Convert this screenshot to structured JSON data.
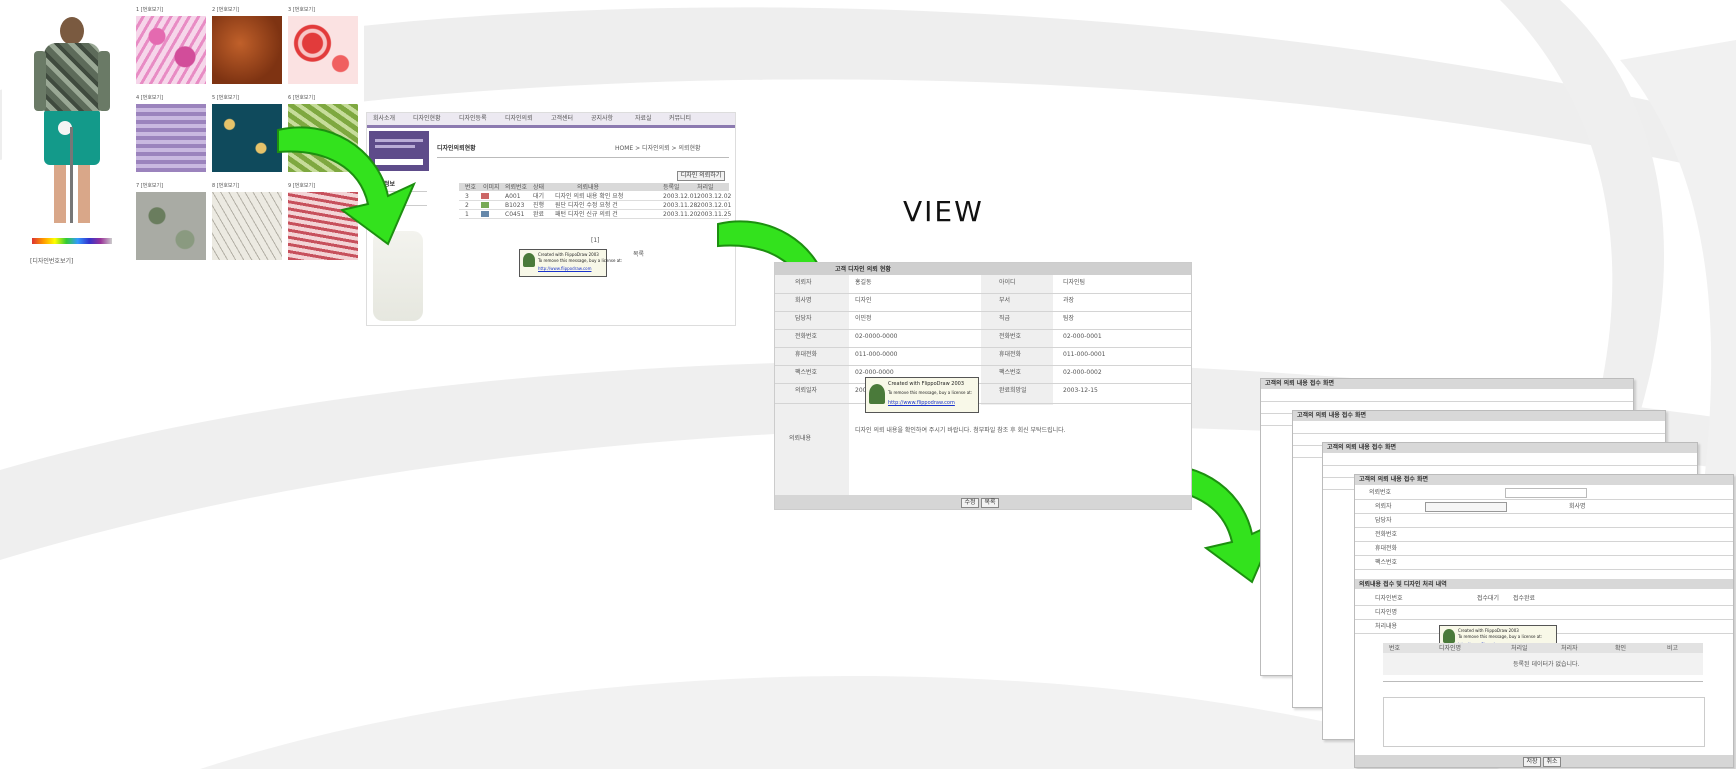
{
  "view_label": "VIEW",
  "step1": {
    "swatch_headers": [
      "1 [번호보기]",
      "2 [번호보기]",
      "3 [번호보기]",
      "4 [번호보기]",
      "5 [번호보기]",
      "6 [번호보기]",
      "7 [번호보기]",
      "8 [번호보기]",
      "9 [번호보기]"
    ],
    "caption": "[디자인번호보기]"
  },
  "step2": {
    "nav_items": [
      "회사소개",
      "디자인현황",
      "디자인등록",
      "디자인의뢰",
      "고객센터",
      "공지사항",
      "자료실",
      "커뮤니티"
    ],
    "sidebar_title": "회원정보",
    "page_title": "디자인의뢰현황",
    "breadcrumb": "HOME > 디자인의뢰 > 의뢰현황",
    "table_headers": [
      "번호",
      "이미지",
      "의뢰번호",
      "상태",
      "의뢰내용",
      "등록일",
      "처리일"
    ],
    "rows": [
      [
        "3",
        "",
        "A001",
        "대기",
        "디자인 의뢰 내용 확인 요청",
        "2003.12.01",
        "2003.12.02"
      ],
      [
        "2",
        "",
        "B1023",
        "진행",
        "원단 디자인 수정 요청 건",
        "2003.11.28",
        "2003.12.01"
      ],
      [
        "1",
        "",
        "C0451",
        "완료",
        "패턴 디자인 신규 의뢰 건",
        "2003.11.20",
        "2003.11.25"
      ]
    ],
    "pager": "[1]",
    "list_button": "목록"
  },
  "popup": {
    "text_line1": "Created with FlippoDraw 2003",
    "text_line2": "To remove this message, buy a license at:",
    "link": "http://www.flippodraw.com"
  },
  "step3": {
    "section_title": "고객 디자인 의뢰 현황",
    "labels_left": [
      "의뢰자",
      "회사명",
      "담당자",
      "전화번호",
      "휴대전화",
      "팩스번호",
      "의뢰일자"
    ],
    "values_left": [
      "홍길동",
      "디자인",
      "이민정",
      "02-0000-0000",
      "011-000-0000",
      "02-000-0000",
      "2003-12-01"
    ],
    "labels_right": [
      "아이디",
      "부서",
      "직급",
      "전화번호",
      "휴대전화",
      "팩스번호",
      "완료희망일"
    ],
    "values_right": [
      "디자인팀",
      "과장",
      "팀장",
      "02-000-0001",
      "011-000-0001",
      "02-000-0002",
      "2003-12-15"
    ],
    "content_label": "의뢰내용",
    "content_text": "디자인 의뢰 내용을 확인하여 주시기 바랍니다. 첨부파일 참조 후 회신 부탁드립니다.",
    "buttons": [
      "수정",
      "목록"
    ]
  },
  "step4": {
    "sheet_title": "고객의 의뢰 내용 접수 화면",
    "field_labels": [
      "의뢰번호",
      "의뢰자",
      "회사명",
      "담당자",
      "전화번호",
      "휴대전화",
      "팩스번호"
    ],
    "section2_title": "의뢰내용 접수 및 디자인 처리 내역",
    "section2_labels": [
      "디자인번호",
      "디자인명",
      "처리내용"
    ],
    "radio_options": [
      "접수대기",
      "접수완료"
    ],
    "table_headers": [
      "번호",
      "디자인명",
      "처리일",
      "처리자",
      "확인",
      "비고"
    ],
    "empty_message": "등록된 데이터가 없습니다.",
    "buttons": [
      "저장",
      "취소"
    ]
  }
}
